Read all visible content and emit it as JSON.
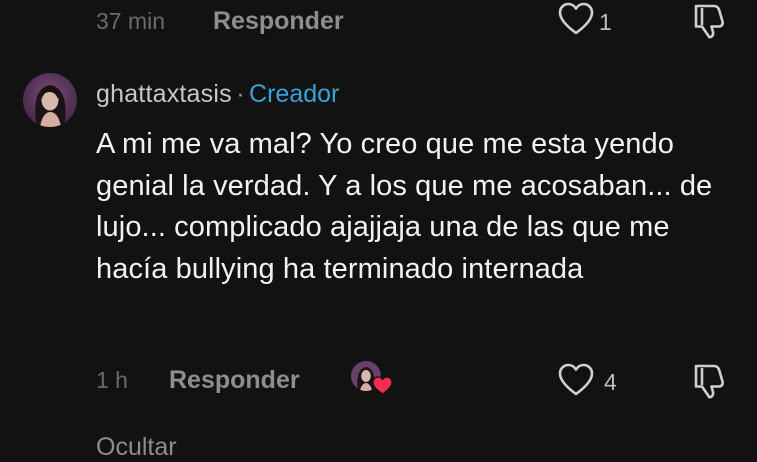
{
  "previous_comment": {
    "time": "37 min",
    "reply_label": "Responder",
    "like_count": "1"
  },
  "comment": {
    "username": "ghattaxtasis",
    "separator": "·",
    "creator_badge": "Creador",
    "text": "A mi me va mal? Yo creo que me esta yendo genial la verdad. Y a los que me acosaban... de lujo... complicado ajajjaja una de las que me hacía bullying ha terminado internada",
    "time": "1 h",
    "reply_label": "Responder",
    "like_count": "4"
  },
  "hidden_replies": {
    "label": "Ocultar"
  },
  "icons": {
    "like": "heart-outline-icon",
    "dislike": "thumbs-down-outline-icon",
    "creator_liked": "heart-filled-icon"
  },
  "colors": {
    "background": "#121212",
    "creator_accent": "#3aa3d6",
    "heart_red": "#fe2c55",
    "muted_text": "#8e8e8e"
  }
}
